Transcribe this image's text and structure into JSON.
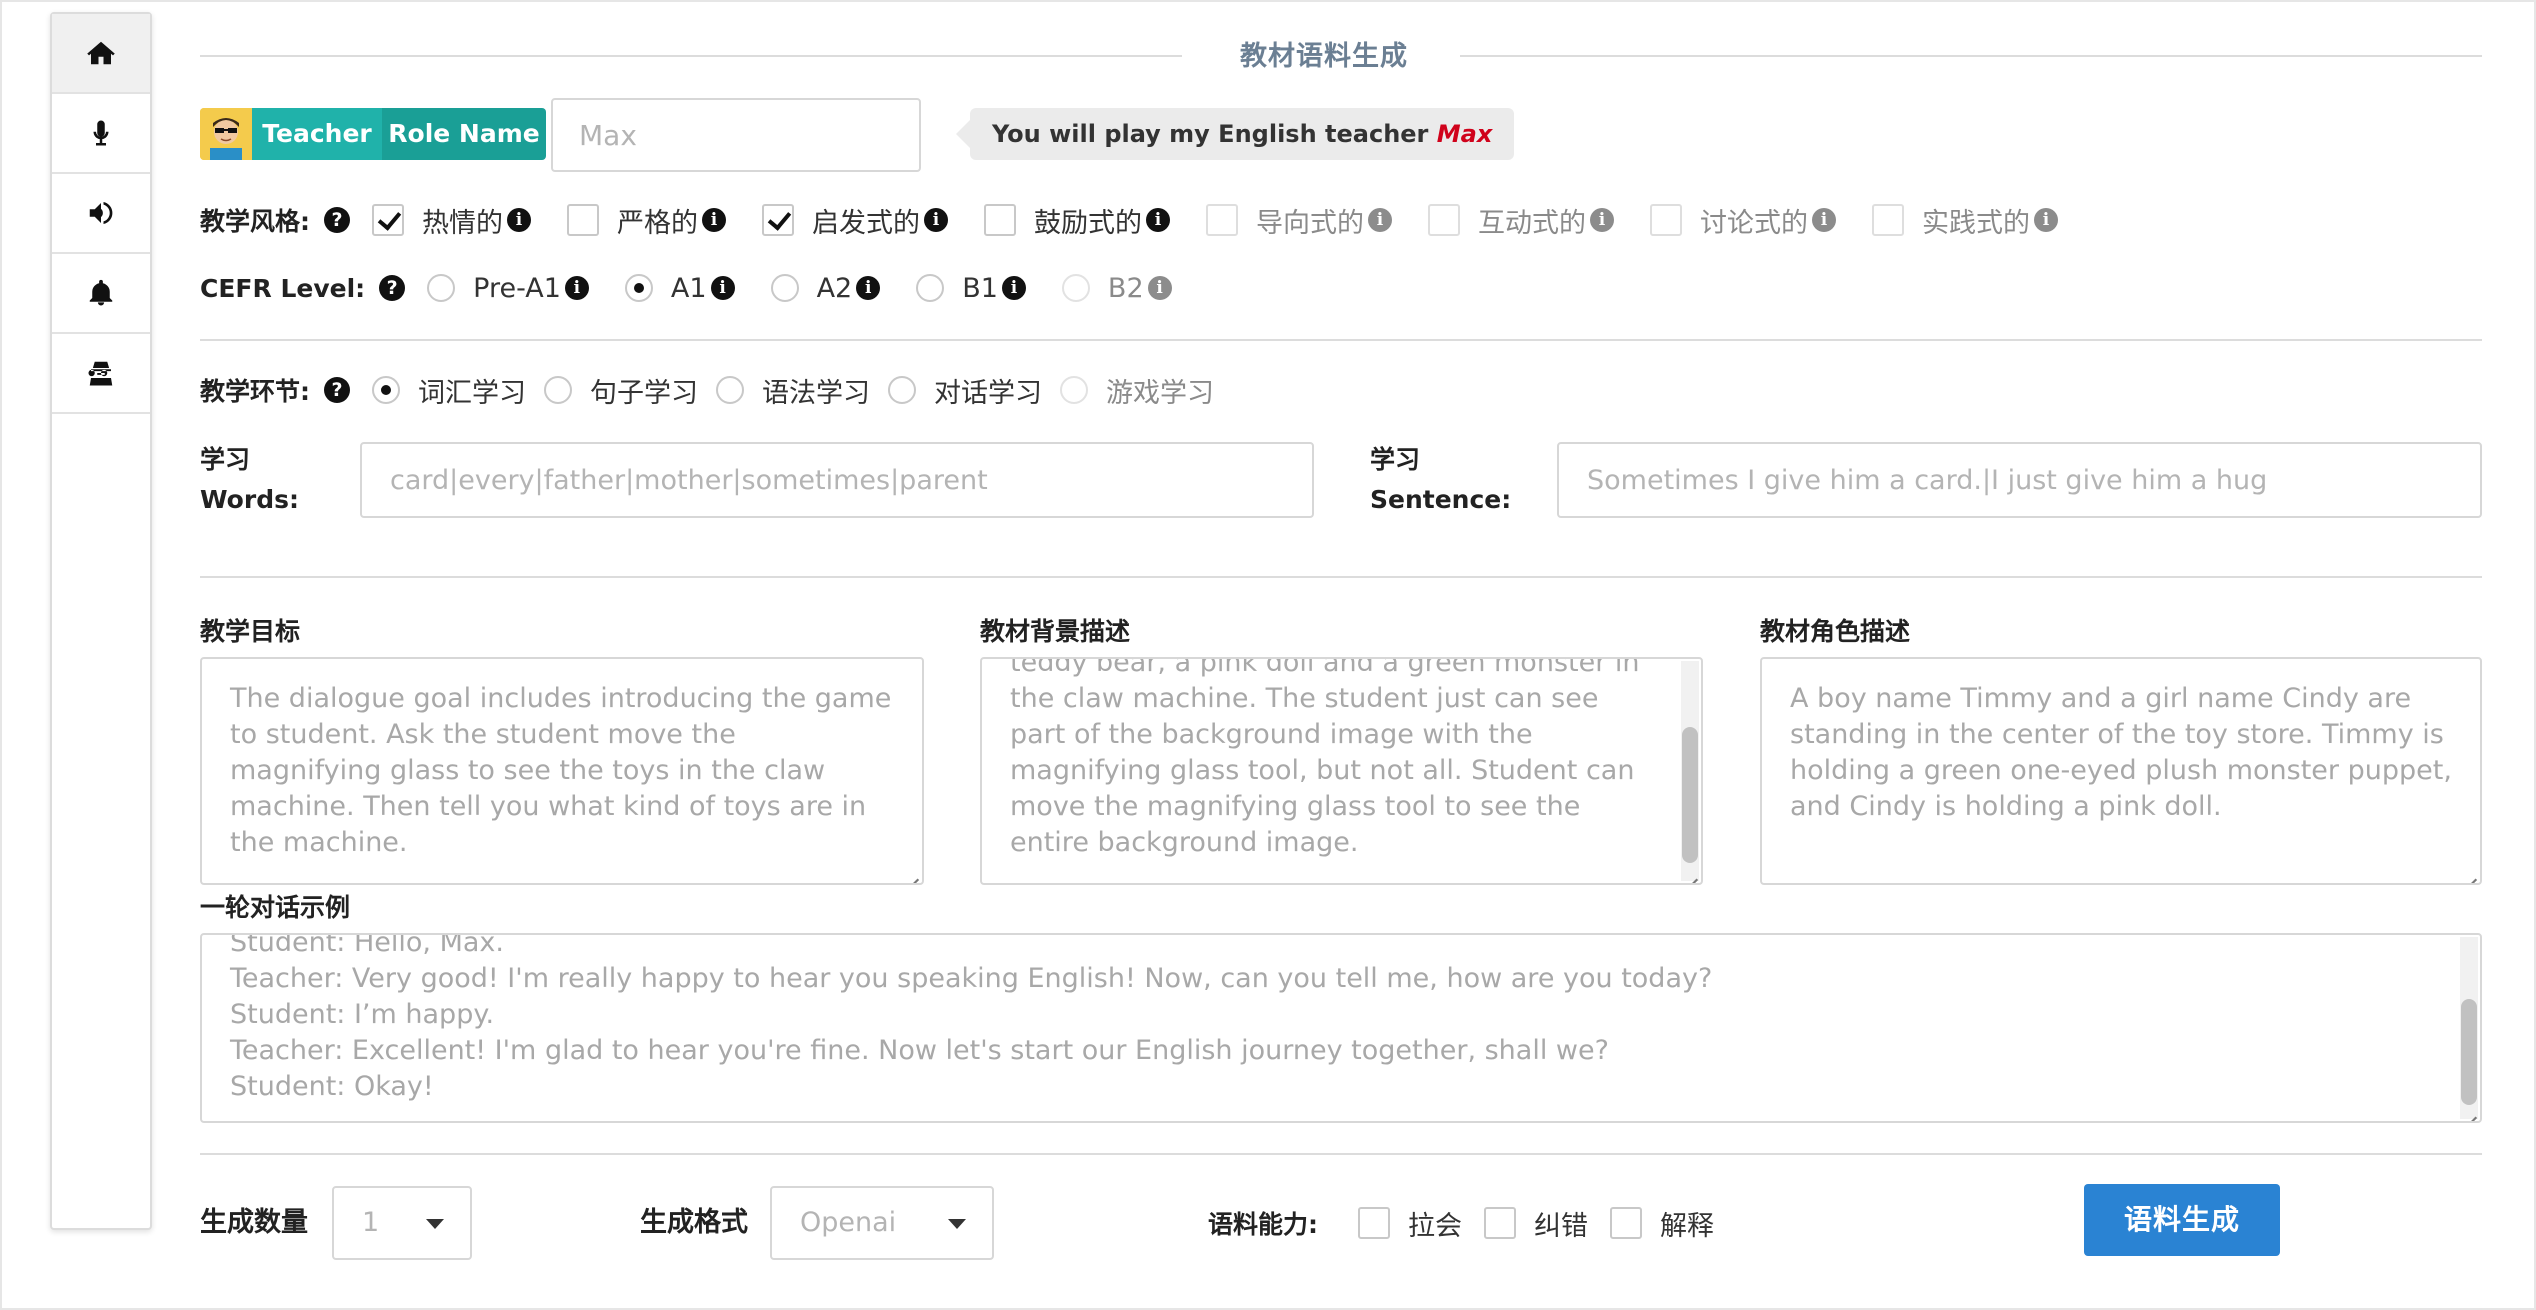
{
  "sidebar": {
    "items": [
      {
        "icon": "home-icon",
        "active": true
      },
      {
        "icon": "microphone-icon",
        "active": false
      },
      {
        "icon": "speaker-icon",
        "active": false
      },
      {
        "icon": "bell-icon",
        "active": false
      },
      {
        "icon": "spy-icon",
        "active": false
      }
    ]
  },
  "header": {
    "title": "教材语料生成"
  },
  "role": {
    "teacher_tag": "Teacher",
    "role_name_tag": "Role Name",
    "name_placeholder": "Max",
    "bubble_prefix": "You will play my English teacher ",
    "bubble_name": "Max"
  },
  "style": {
    "label": "教学风格:",
    "options": [
      {
        "label": "热情的",
        "checked": true,
        "enabled": true
      },
      {
        "label": "严格的",
        "checked": false,
        "enabled": true
      },
      {
        "label": "启发式的",
        "checked": true,
        "enabled": true
      },
      {
        "label": "鼓励式的",
        "checked": false,
        "enabled": true
      },
      {
        "label": "导向式的",
        "checked": false,
        "enabled": false
      },
      {
        "label": "互动式的",
        "checked": false,
        "enabled": false
      },
      {
        "label": "讨论式的",
        "checked": false,
        "enabled": false
      },
      {
        "label": "实践式的",
        "checked": false,
        "enabled": false
      }
    ]
  },
  "cefr": {
    "label": "CEFR Level:",
    "options": [
      {
        "label": "Pre-A1",
        "selected": false,
        "enabled": true
      },
      {
        "label": "A1",
        "selected": true,
        "enabled": true
      },
      {
        "label": "A2",
        "selected": false,
        "enabled": true
      },
      {
        "label": "B1",
        "selected": false,
        "enabled": true
      },
      {
        "label": "B2",
        "selected": false,
        "enabled": false
      }
    ]
  },
  "section": {
    "label": "教学环节:",
    "options": [
      {
        "label": "词汇学习",
        "selected": true,
        "enabled": true
      },
      {
        "label": "句子学习",
        "selected": false,
        "enabled": true
      },
      {
        "label": "语法学习",
        "selected": false,
        "enabled": true
      },
      {
        "label": "对话学习",
        "selected": false,
        "enabled": true
      },
      {
        "label": "游戏学习",
        "selected": false,
        "enabled": false
      }
    ]
  },
  "words": {
    "label_line1": "学习",
    "label_line2": "Words:",
    "placeholder": "card|every|father|mother|sometimes|parent"
  },
  "sentence": {
    "label_line1": "学习",
    "label_line2": "Sentence:",
    "placeholder": "Sometimes I give him a card.|I just give him a hug"
  },
  "goal": {
    "label": "教学目标",
    "text": "The dialogue goal includes introducing the game to student. Ask the student move the magnifying glass to see the toys in the claw machine. Then tell you what kind of toys are in the machine."
  },
  "background": {
    "label": "教材背景描述",
    "text": "teddy bear, a pink doll and a green monster in the claw machine. The student just can see part of the background image with the magnifying glass tool, but not all. Student can move the magnifying glass tool to see the entire background image."
  },
  "roles_desc": {
    "label": "教材角色描述",
    "text": "A boy name Timmy and a girl name Cindy are standing in the center of the toy store. Timmy is holding a green one-eyed plush monster puppet, and Cindy is holding a pink doll."
  },
  "dialogue": {
    "label": "一轮对话示例",
    "lines": [
      "Student:  Hello, Max.",
      "Teacher:  Very good! I'm really happy to hear you speaking English! Now, can you tell me, how are you today?",
      "Student:  I’m happy.",
      "Teacher:  Excellent! I'm glad to hear you're fine. Now let's start our English journey together, shall we?",
      "Student:  Okay!"
    ]
  },
  "bottom": {
    "count_label": "生成数量",
    "count_value": "1",
    "format_label": "生成格式",
    "format_value": "Openai",
    "ability_label": "语料能力:",
    "abilities": [
      {
        "label": "拉会",
        "checked": false
      },
      {
        "label": "纠错",
        "checked": false
      },
      {
        "label": "解释",
        "checked": false
      }
    ],
    "generate_label": "语料生成"
  }
}
